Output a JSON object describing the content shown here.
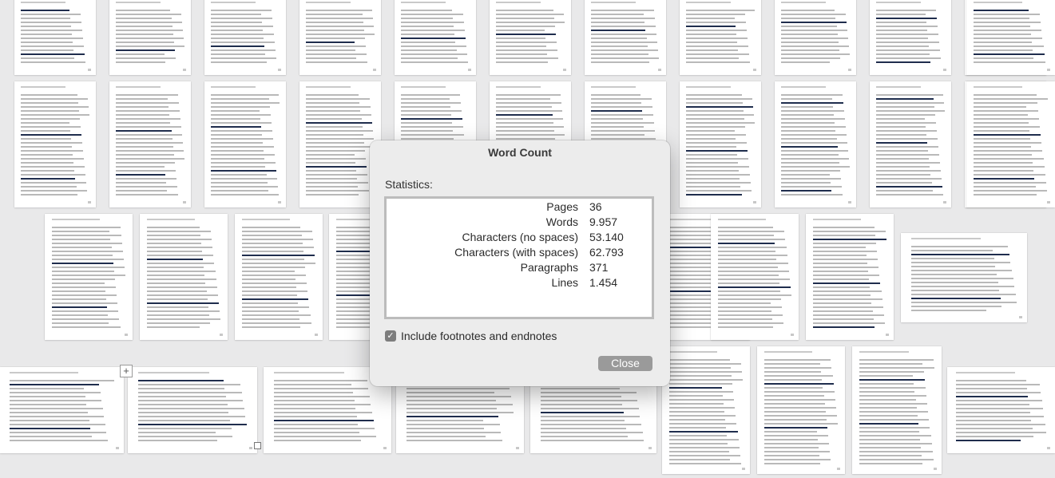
{
  "dialog": {
    "title": "Word Count",
    "statistics_heading": "Statistics:",
    "stats": [
      {
        "label": "Pages",
        "value": "36"
      },
      {
        "label": "Words",
        "value": "9.957"
      },
      {
        "label": "Characters (no spaces)",
        "value": "53.140"
      },
      {
        "label": "Characters (with spaces)",
        "value": "62.793"
      },
      {
        "label": "Paragraphs",
        "value": "371"
      },
      {
        "label": "Lines",
        "value": "1.454"
      }
    ],
    "include_footnotes_label": "Include footnotes and endnotes",
    "include_footnotes_checked": true,
    "close_label": "Close"
  },
  "document": {
    "page_count_shown": 36
  },
  "colors": {
    "background": "#e9e9ea",
    "dialog_bg": "#ececec",
    "close_button": "#9a9a9a",
    "heading_navy": "#1f2d4d",
    "chart_blue": "#24427a"
  },
  "icons": {
    "add": "plus-icon",
    "checkbox": "checkmark-icon"
  }
}
